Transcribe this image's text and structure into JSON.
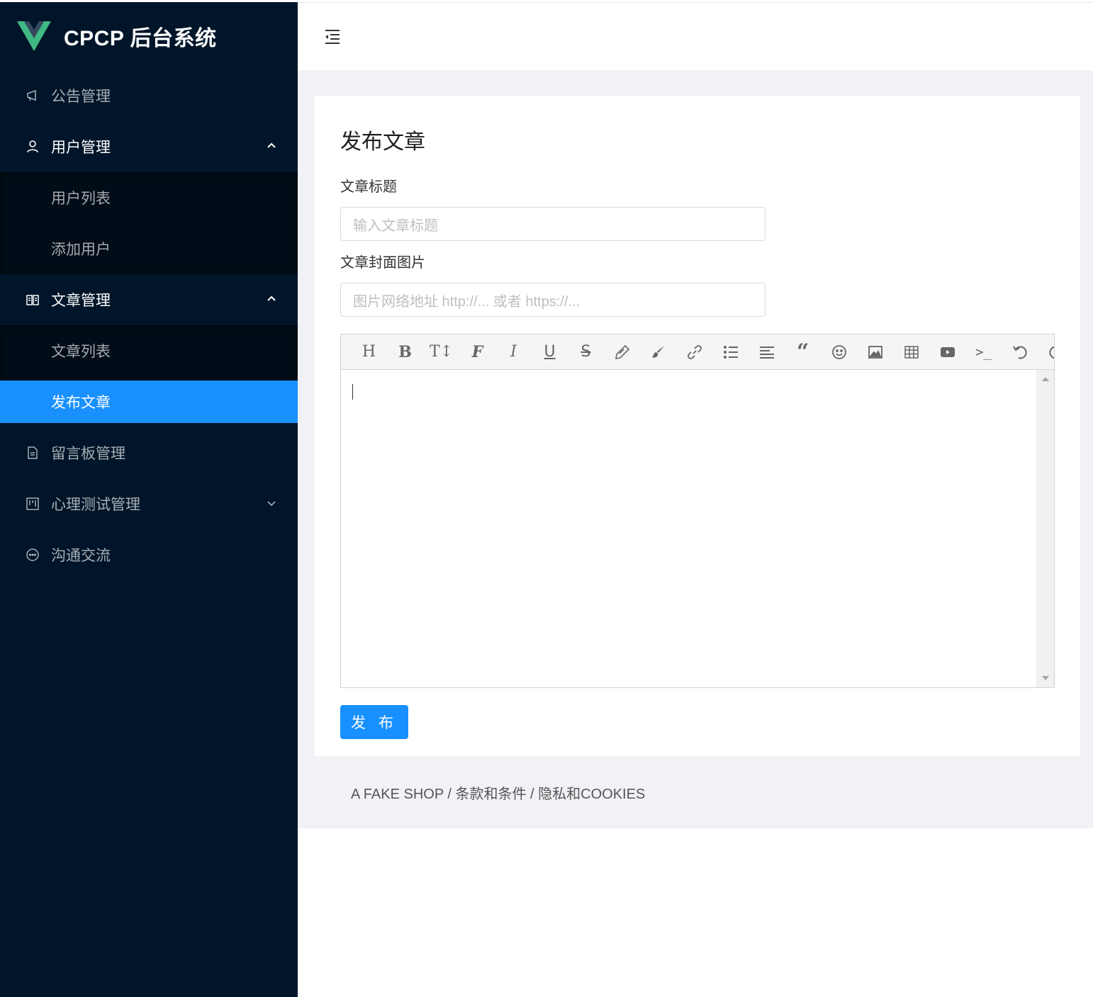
{
  "app": {
    "title": "CPCP 后台系统",
    "brand_color": "#001529",
    "accent_color": "#1890ff"
  },
  "sidebar": {
    "items": [
      {
        "label": "公告管理",
        "icon": "notification-icon"
      },
      {
        "label": "用户管理",
        "icon": "user-icon",
        "expanded": true,
        "children": [
          {
            "label": "用户列表"
          },
          {
            "label": "添加用户"
          }
        ]
      },
      {
        "label": "文章管理",
        "icon": "read-icon",
        "expanded": true,
        "children": [
          {
            "label": "文章列表"
          },
          {
            "label": "发布文章",
            "active": true
          }
        ]
      },
      {
        "label": "留言板管理",
        "icon": "file-text-icon"
      },
      {
        "label": "心理测试管理",
        "icon": "project-icon",
        "expanded": false
      },
      {
        "label": "沟通交流",
        "icon": "message-icon"
      }
    ]
  },
  "header": {
    "toggle_icon": "menu-fold-icon"
  },
  "page": {
    "title": "发布文章",
    "fields": {
      "title_label": "文章标题",
      "title_placeholder": "输入文章标题",
      "cover_label": "文章封面图片",
      "cover_placeholder": "图片网络地址 http://... 或者 https://..."
    },
    "editor": {
      "toolbar": [
        "heading-icon",
        "bold-icon",
        "text-size-icon",
        "font-icon",
        "italic-icon",
        "underline-icon",
        "strikethrough-icon",
        "highlight-icon",
        "brush-icon",
        "link-icon",
        "bullet-list-icon",
        "align-icon",
        "quote-icon",
        "emoji-icon",
        "image-icon",
        "table-icon",
        "video-icon",
        "code-icon",
        "undo-icon",
        "redo-icon"
      ]
    },
    "submit_label": "发 布"
  },
  "footer": {
    "text": "A FAKE SHOP / 条款和条件 / 隐私和COOKIES"
  }
}
